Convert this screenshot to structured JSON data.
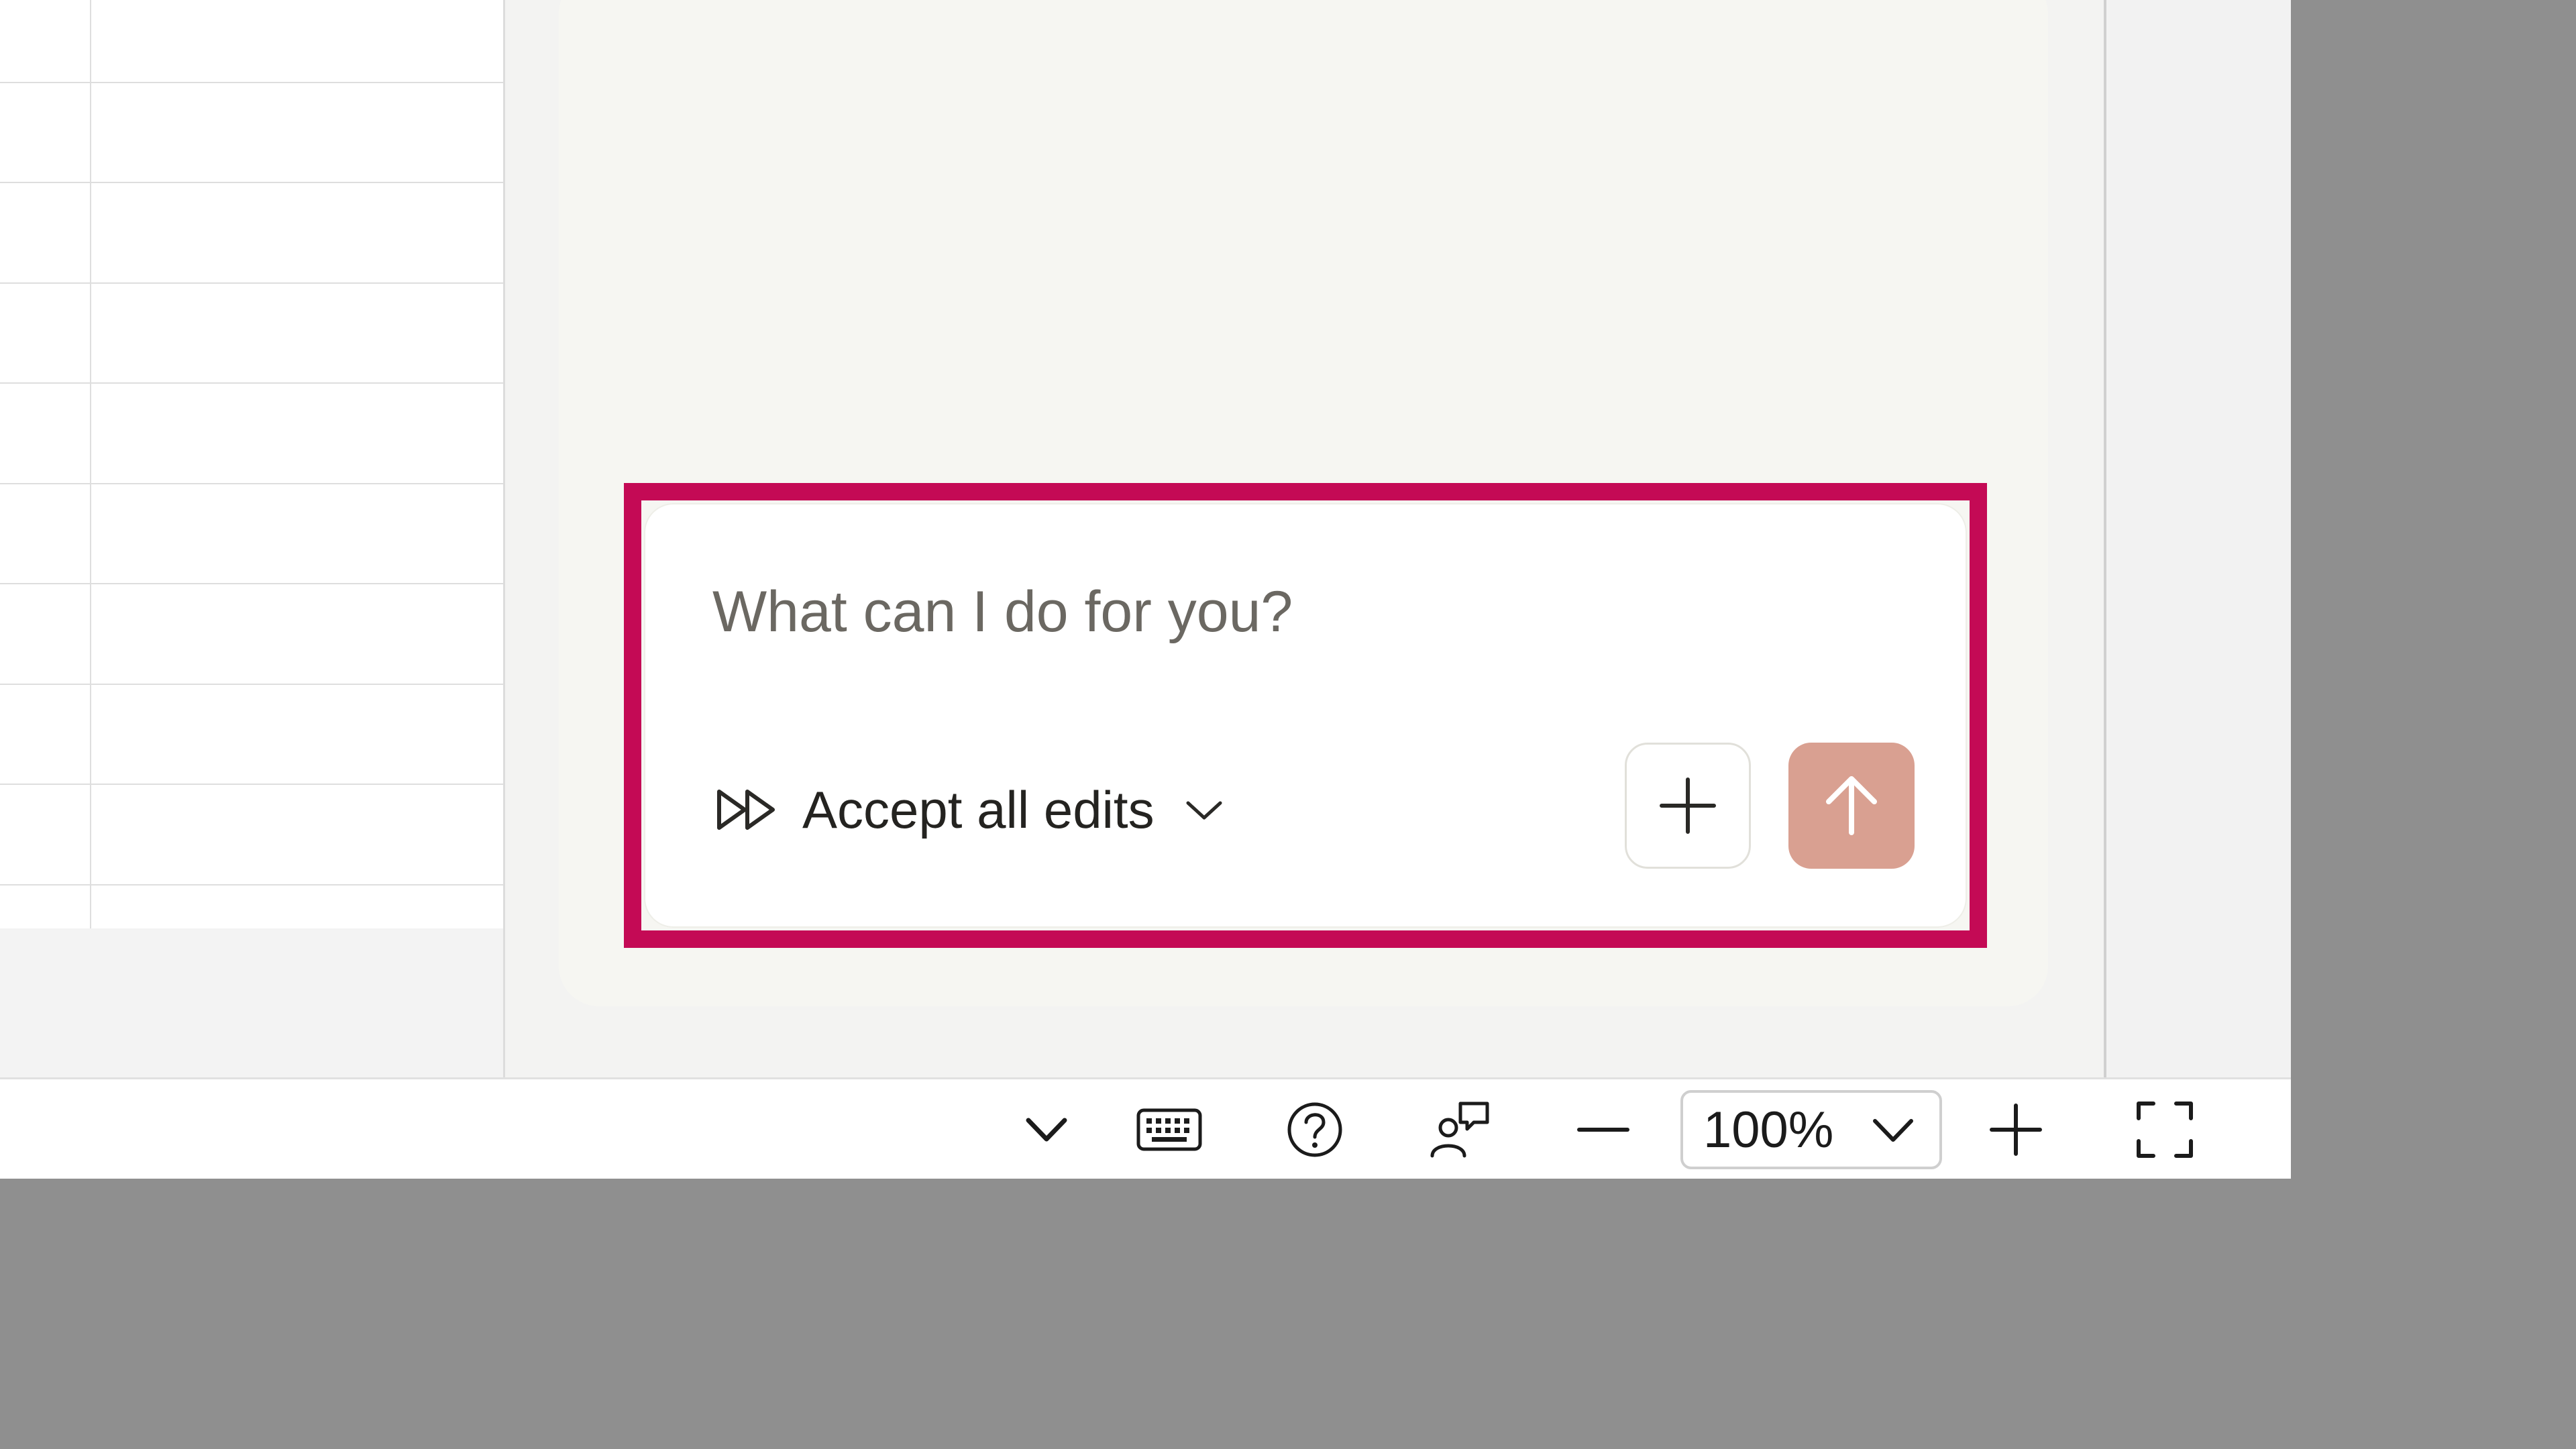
{
  "composer": {
    "placeholder": "What can I do for you?",
    "mode_label": "Accept all edits"
  },
  "statusbar": {
    "zoom_value": "100%"
  },
  "icons": {
    "mode": "fast-forward-icon",
    "mode_menu": "chevron-down-icon",
    "attach": "plus-icon",
    "send": "arrow-up-icon",
    "collapse": "chevron-down-icon",
    "keyboard": "keyboard-icon",
    "help": "help-circle-icon",
    "feedback": "feedback-icon",
    "zoom_out": "minus-icon",
    "zoom_in": "plus-icon",
    "fullscreen": "fullscreen-icon"
  },
  "colors": {
    "highlight_border": "#c40a55",
    "send_button": "#d9a091"
  }
}
